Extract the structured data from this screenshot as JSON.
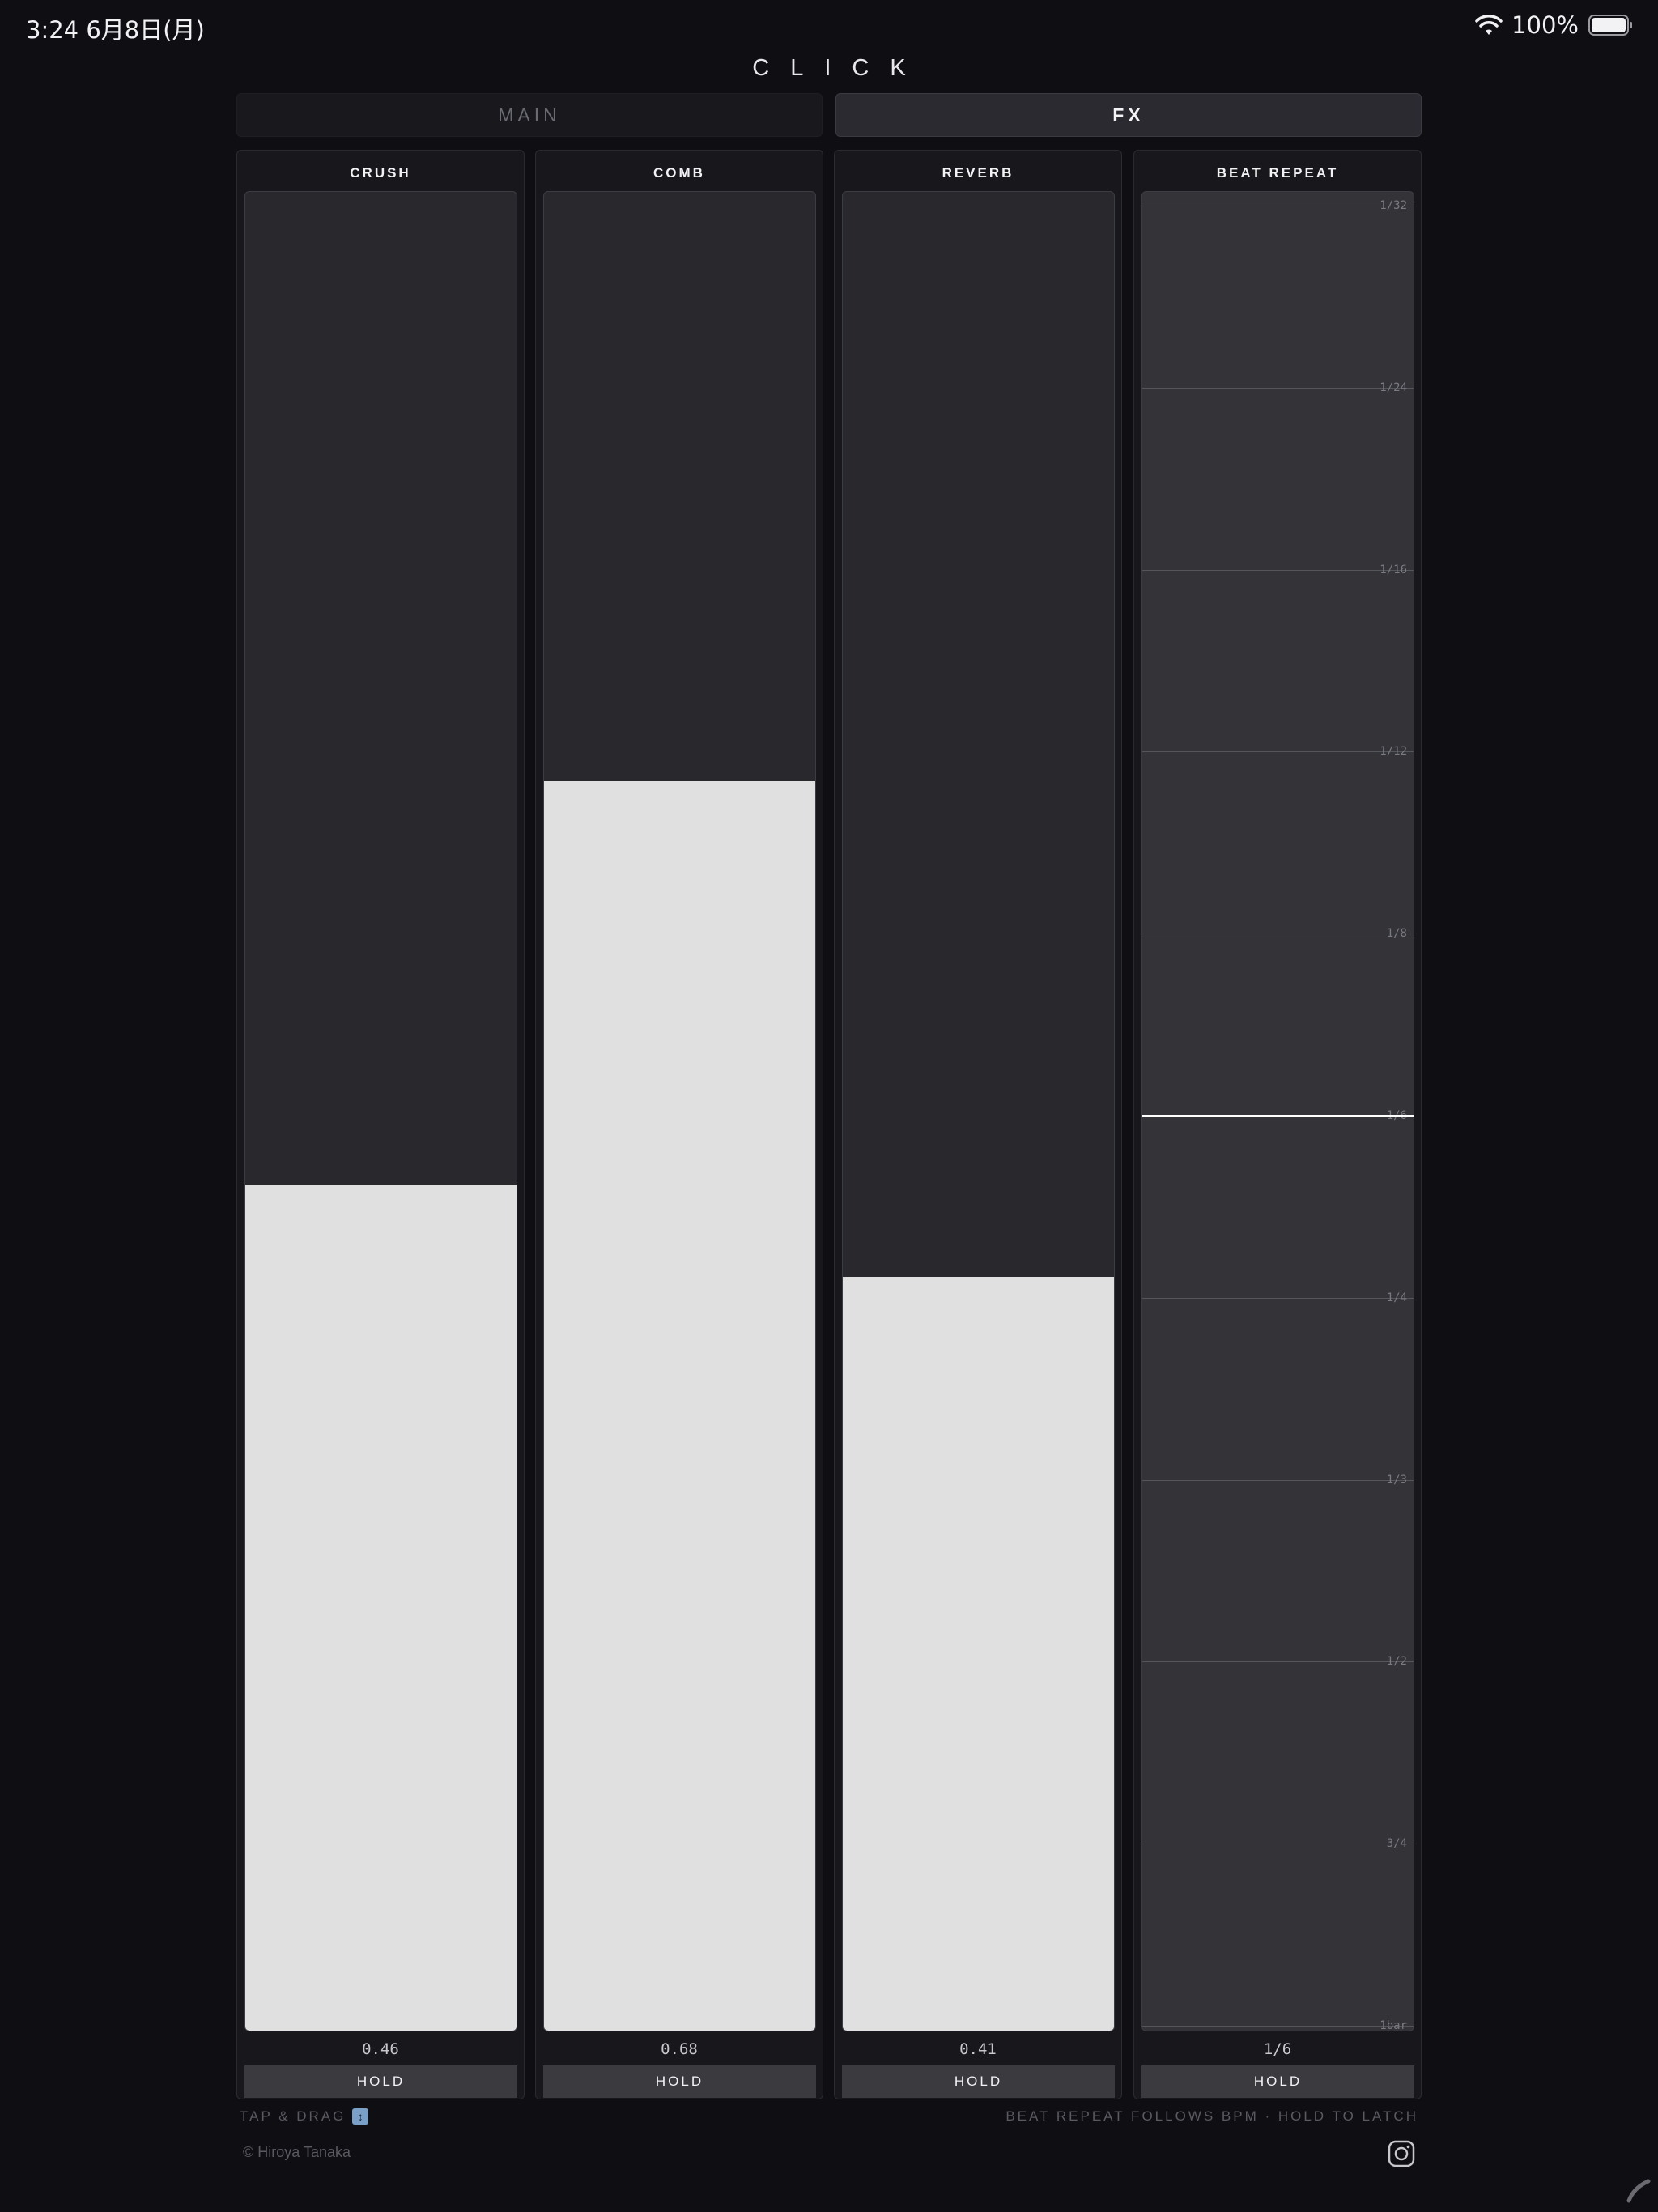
{
  "status_bar": {
    "time_date": "3:24   6月8日(月)",
    "battery": "100%"
  },
  "app": {
    "title": "CLICK"
  },
  "tabs": [
    {
      "label": "MAIN",
      "selected": false
    },
    {
      "label": "FX",
      "selected": true
    }
  ],
  "panels": [
    {
      "title": "CRUSH",
      "value": "0.46",
      "level": 0.46,
      "hold": "HOLD"
    },
    {
      "title": "COMB",
      "value": "0.68",
      "level": 0.68,
      "hold": "HOLD"
    },
    {
      "title": "REVERB",
      "value": "0.41",
      "level": 0.41,
      "hold": "HOLD"
    }
  ],
  "beat_repeat": {
    "title": "BEAT REPEAT",
    "value": "1/6",
    "hold": "HOLD",
    "steps": [
      "1/32",
      "1/24",
      "1/16",
      "1/12",
      "1/8",
      "1/6",
      "1/4",
      "1/3",
      "1/2",
      "3/4",
      "1bar"
    ],
    "selected_step": "1/6"
  },
  "footer": {
    "hint_left": "TAP & DRAG",
    "hint_right": "BEAT REPEAT FOLLOWS BPM · HOLD TO LATCH",
    "copyright": "© Hiroya Tanaka"
  },
  "colors": {
    "background": "#0f0f13",
    "fader_fill": "#e0e0e0",
    "fader_track": "#28282d",
    "beat_track": "#333338",
    "hold_button": "#3a3a3f"
  },
  "icons": [
    "wifi-icon",
    "battery-icon",
    "updown-icon",
    "instagram-icon",
    "edit-icon"
  ]
}
